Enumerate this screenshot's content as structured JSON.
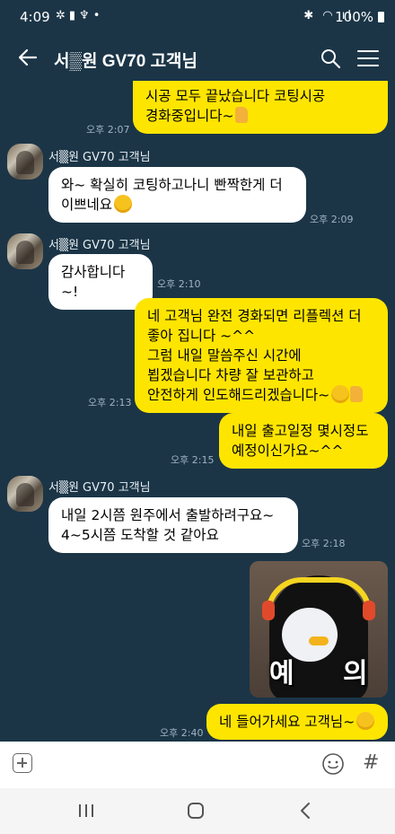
{
  "status_bar": {
    "time": "4:09",
    "battery": "100%"
  },
  "header": {
    "title": "서▒원 GV70 고객님"
  },
  "messages": {
    "m1": {
      "text": "시공 모두 끝났습니다 코팅시공\n경화중입니다~",
      "time": "오후 2:07"
    },
    "m2": {
      "sender": "서▒원 GV70 고객님",
      "text": "와~ 확실히 코팅하고나니 빤짝한게 더\n이쁘네요",
      "time": "오후 2:09"
    },
    "m3": {
      "sender": "서▒원 GV70 고객님",
      "text": "감사합니다~!",
      "time": "오후 2:10"
    },
    "m4": {
      "text": "네 고객님 완전 경화되면 리플렉션 더\n좋아 집니다 ~^^\n그럼 내일 말씀주신 시간에\n뵙겠습니다 차량 잘 보관하고\n안전하게 인도해드리겠습니다~",
      "time": "오후 2:13"
    },
    "m5": {
      "text": "내일 출고일정 몇시정도\n예정이신가요~^^",
      "time": "오후 2:15"
    },
    "m6": {
      "sender": "서▒원 GV70 고객님",
      "text": "내일 2시쯤 원주에서 출발하려구요~\n4~5시쯤 도착할 것 같아요",
      "time": "오후 2:18"
    },
    "sticker": {
      "left_char": "예",
      "right_char": "의"
    },
    "m7": {
      "text": "네 들어가세요 고객님~",
      "time": "오후 2:40"
    }
  },
  "input_bar": {
    "hash_label": "#"
  },
  "icons": {
    "back": "arrow-left-icon",
    "search": "search-icon",
    "menu": "hamburger-menu-icon",
    "attach": "plus-icon",
    "emoji": "smile-icon",
    "hash": "hash-icon"
  },
  "colors": {
    "background": "#1b3547",
    "my_bubble": "#fee500",
    "their_bubble": "#ffffff"
  }
}
